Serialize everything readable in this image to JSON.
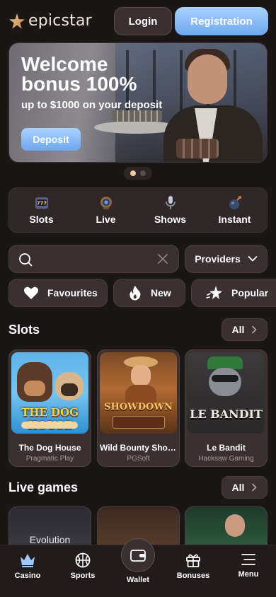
{
  "header": {
    "brand": "epicstar",
    "login_label": "Login",
    "registration_label": "Registration"
  },
  "banner": {
    "title_line1": "Welcome",
    "title_line2": "bonus 100%",
    "subtitle": "up to $1000 on your deposit",
    "deposit_label": "Deposit",
    "slides_total": 2,
    "active_slide": 1
  },
  "categories": [
    {
      "label": "Slots",
      "icon": "slot-machine-icon"
    },
    {
      "label": "Live",
      "icon": "live-camera-icon"
    },
    {
      "label": "Shows",
      "icon": "microphone-icon"
    },
    {
      "label": "Instant",
      "icon": "bomb-icon"
    }
  ],
  "search": {
    "placeholder": "",
    "value": "",
    "providers_label": "Providers"
  },
  "filters": [
    {
      "label": "Favourites",
      "icon": "heart-icon"
    },
    {
      "label": "New",
      "icon": "flame-icon"
    },
    {
      "label": "Popular",
      "icon": "sparkle-star-icon"
    }
  ],
  "slots_section": {
    "title": "Slots",
    "all_label": "All",
    "games": [
      {
        "name": "The Dog House",
        "provider": "Pragmatic Play",
        "logo_text": "THE DOG HOUSE"
      },
      {
        "name": "Wild Bounty Show...",
        "provider": "PGSoft",
        "logo_text": "SHOWDOWN"
      },
      {
        "name": "Le Bandit",
        "provider": "Hacksaw Gaming",
        "logo_text": "LE BANDIT"
      }
    ]
  },
  "live_section": {
    "title": "Live games",
    "all_label": "All",
    "first_card_text": "Evolution"
  },
  "bottom_nav": [
    {
      "label": "Casino",
      "icon": "crown-icon"
    },
    {
      "label": "Sports",
      "icon": "basketball-icon"
    },
    {
      "label": "Wallet",
      "icon": "wallet-icon"
    },
    {
      "label": "Bonuses",
      "icon": "gift-icon"
    },
    {
      "label": "Menu",
      "icon": "hamburger-menu-icon"
    }
  ],
  "colors": {
    "background": "#1b1616",
    "surface": "#3a3031",
    "accent_blue": "#8cbcf8",
    "logo_gold": "#e8b07a"
  }
}
